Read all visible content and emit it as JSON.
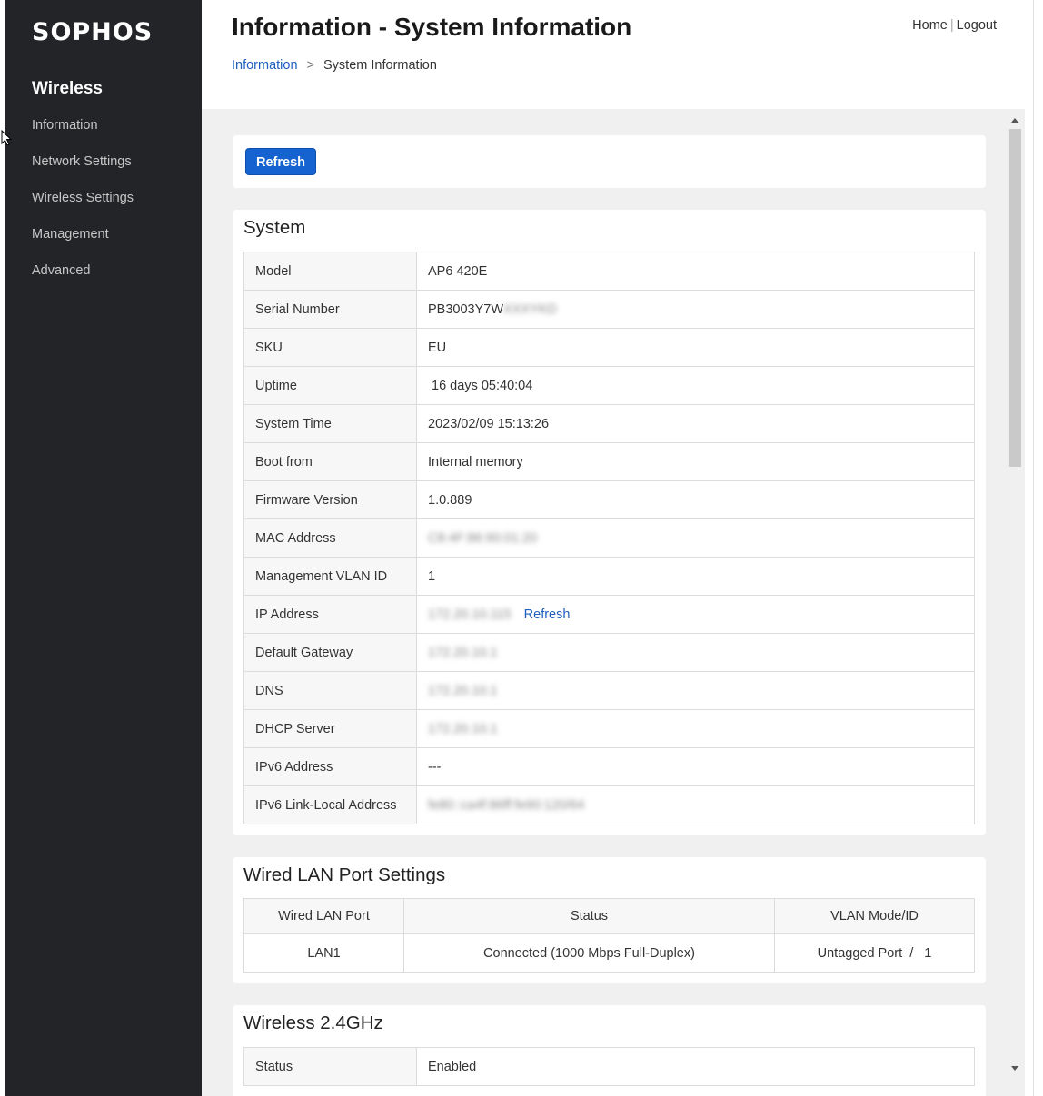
{
  "sidebar": {
    "logo": "SOPHOS",
    "heading": "Wireless",
    "items": [
      {
        "label": "Information"
      },
      {
        "label": "Network Settings"
      },
      {
        "label": "Wireless Settings"
      },
      {
        "label": "Management"
      },
      {
        "label": "Advanced"
      }
    ]
  },
  "header": {
    "title": "Information - System Information",
    "links": {
      "home": "Home",
      "separator": "|",
      "logout": "Logout"
    },
    "breadcrumb": {
      "parent": "Information",
      "chevron": ">",
      "current": "System Information"
    }
  },
  "actions": {
    "refresh_label": "Refresh"
  },
  "system": {
    "title": "System",
    "rows": [
      {
        "label": "Model",
        "value": "AP6 420E"
      },
      {
        "label": "Serial Number",
        "value": "PB3003Y7W",
        "blurred": "XXXYKD"
      },
      {
        "label": "SKU",
        "value": "EU"
      },
      {
        "label": "Uptime",
        "value": " 16 days 05:40:04"
      },
      {
        "label": "System Time",
        "value": "2023/02/09 15:13:26"
      },
      {
        "label": "Boot from",
        "value": "Internal memory"
      },
      {
        "label": "Firmware Version",
        "value": "1.0.889"
      },
      {
        "label": "MAC Address",
        "blurred": "C8:4F:86:90:01:20"
      },
      {
        "label": "Management VLAN ID",
        "value": "1"
      },
      {
        "label": "IP Address",
        "blurred": "172.20.10.115",
        "link": "Refresh"
      },
      {
        "label": "Default Gateway",
        "blurred": "172.20.10.1"
      },
      {
        "label": "DNS",
        "blurred": "172.20.10.1"
      },
      {
        "label": "DHCP Server",
        "blurred": "172.20.10.1"
      },
      {
        "label": "IPv6 Address",
        "value": "---"
      },
      {
        "label": "IPv6 Link-Local Address",
        "blurred": "fe80::ca4f:86ff:fe90:120/64"
      }
    ]
  },
  "wired": {
    "title": "Wired LAN Port Settings",
    "headers": [
      "Wired LAN Port",
      "Status",
      "VLAN Mode/ID"
    ],
    "rows": [
      [
        "LAN1",
        "Connected (1000 Mbps Full-Duplex)",
        "Untagged Port  /   1"
      ]
    ]
  },
  "wireless24": {
    "title": "Wireless 2.4GHz",
    "rows": [
      {
        "label": "Status",
        "value": "Enabled"
      }
    ]
  }
}
